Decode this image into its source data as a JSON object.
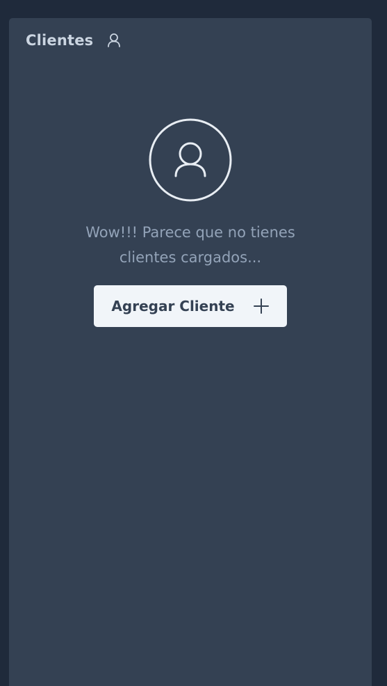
{
  "panel": {
    "title": "Clientes",
    "title_icon": "user-icon"
  },
  "empty_state": {
    "icon": "user-circle-icon",
    "message": "Wow!!! Parece que no tienes clientes cargados...",
    "button_label": "Agregar Cliente",
    "button_icon": "plus-icon"
  },
  "colors": {
    "page_background": "#1f2a3b",
    "panel_background": "#344153",
    "title_text": "#cbd5e1",
    "message_text": "#93a3b8",
    "button_background": "#f1f5f9",
    "button_text": "#344153"
  }
}
